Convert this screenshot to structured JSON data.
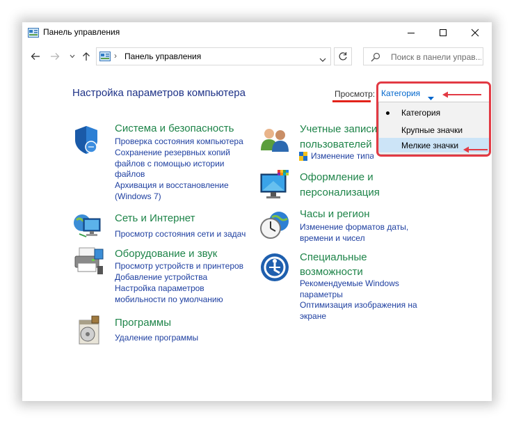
{
  "window": {
    "title": "Панель управления",
    "minimize": "minimize-icon",
    "maximize": "maximize-icon",
    "close": "close-icon"
  },
  "address": {
    "path": "Панель управления",
    "search_placeholder": "Поиск в панели управ..."
  },
  "header": {
    "title": "Настройка параметров компьютера",
    "view_label": "Просмотр:",
    "view_value": "Категория"
  },
  "view_menu": {
    "items": [
      {
        "label": "Категория",
        "selected": true
      },
      {
        "label": "Крупные значки",
        "selected": false
      },
      {
        "label": "Мелкие значки",
        "selected": false,
        "highlighted": true
      }
    ]
  },
  "categories_left": [
    {
      "title": "Система и безопасность",
      "icon": "shield-icon",
      "links": [
        "Проверка состояния компьютера",
        "Сохранение резервных копий файлов с помощью истории файлов",
        "Архивация и восстановление (Windows 7)"
      ]
    },
    {
      "title": "Сеть и Интернет",
      "icon": "network-globe-icon",
      "links": [
        "Просмотр состояния сети и задач"
      ]
    },
    {
      "title": "Оборудование и звук",
      "icon": "printer-icon",
      "links": [
        "Просмотр устройств и принтеров",
        "Добавление устройства",
        "Настройка параметров мобильности по умолчанию"
      ]
    },
    {
      "title": "Программы",
      "icon": "programs-disc-icon",
      "links": [
        "Удаление программы"
      ]
    }
  ],
  "categories_right": [
    {
      "title": "Учетные записи пользователей",
      "icon": "users-icon",
      "links": [
        "Изменение типа учетной записи"
      ]
    },
    {
      "title": "Оформление и персонализация",
      "icon": "monitor-palette-icon",
      "links": []
    },
    {
      "title": "Часы и регион",
      "icon": "clock-globe-icon",
      "links": [
        "Изменение форматов даты, времени и чисел"
      ]
    },
    {
      "title": "Специальные возможности",
      "icon": "accessibility-icon",
      "links": [
        "Рекомендуемые Windows параметры",
        "Оптимизация изображения на экране"
      ]
    }
  ],
  "colors": {
    "category_title": "#1e8449",
    "link": "#1e3fa0",
    "page_title": "#1e3287",
    "annotation_red": "#e23a44",
    "menu_highlight": "#cce4f7"
  }
}
